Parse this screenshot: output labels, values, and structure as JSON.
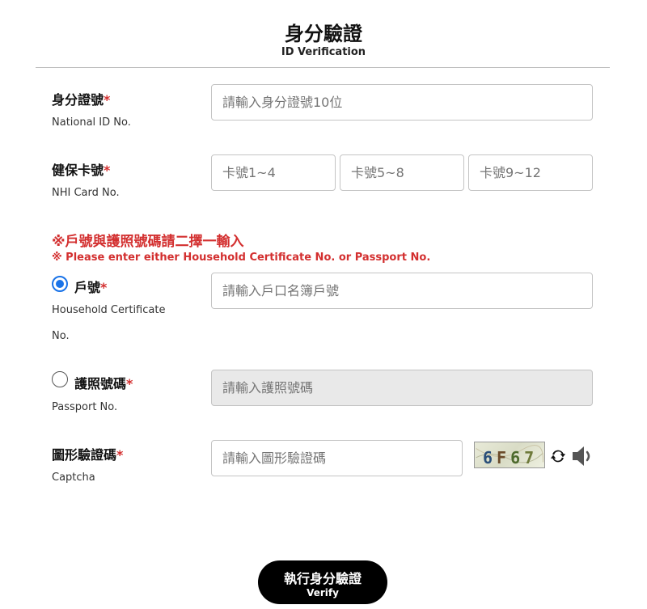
{
  "header": {
    "title": "身分驗證",
    "subtitle": "ID Verification"
  },
  "required_mark": "*",
  "national_id": {
    "label": "身分證號",
    "sublabel": "National ID No.",
    "placeholder": "請輸入身分證號10位"
  },
  "nhi_card": {
    "label": "健保卡號",
    "sublabel": "NHI Card No.",
    "placeholders": [
      "卡號1~4",
      "卡號5~8",
      "卡號9~12"
    ]
  },
  "notice": {
    "zh": "※戶號與護照號碼請二擇一輸入",
    "en": "※ Please enter either Household Certificate No. or Passport No."
  },
  "household": {
    "label": "戶號",
    "sublabel_line1": "Household Certificate",
    "sublabel_line2": "No.",
    "placeholder": "請輸入戶口名簿戶號",
    "selected": true
  },
  "passport": {
    "label": "護照號碼",
    "sublabel": "Passport No.",
    "placeholder": "請輸入護照號碼",
    "selected": false,
    "disabled": true
  },
  "captcha": {
    "label": "圖形驗證碼",
    "sublabel": "Captcha",
    "placeholder": "請輸入圖形驗證碼",
    "chars": [
      "6",
      "F",
      "6",
      "7"
    ],
    "refresh_icon": "refresh-icon",
    "audio_icon": "speaker-icon"
  },
  "verify_button": {
    "label_zh": "執行身分驗證",
    "label_en": "Verify"
  },
  "colors": {
    "required": "#d32f2f",
    "radio_accent": "#1a73e8",
    "button_bg": "#000000"
  }
}
